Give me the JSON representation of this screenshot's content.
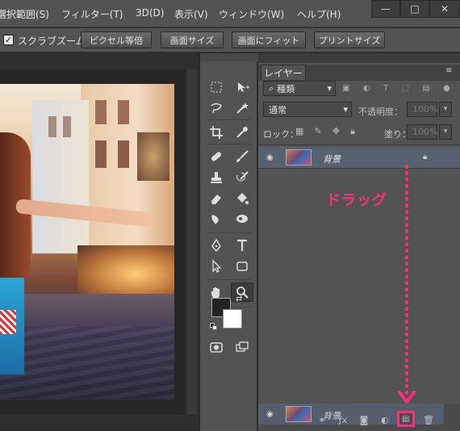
{
  "menu": {
    "items": [
      "選択範囲(S)",
      "フィルター(T)",
      "3D(D)",
      "表示(V)",
      "ウィンドウ(W)",
      "ヘルプ(H)"
    ],
    "window_controls": [
      "—",
      "□",
      "✕"
    ]
  },
  "options": {
    "scrubby_zoom_label": "スクラブズーム",
    "scrubby_zoom_checked": "✓",
    "buttons": [
      "ピクセル等倍",
      "画面サイズ",
      "画面にフィット",
      "プリントサイズ"
    ]
  },
  "layers_panel": {
    "tab_label": "レイヤー",
    "filter_kind": "種類",
    "blend_mode": "通常",
    "opacity_label": "不透明度：",
    "opacity_value": "100%",
    "lock_label": "ロック：",
    "fill_label": "塗り：",
    "fill_value": "100%",
    "layers": [
      {
        "name": "背景",
        "locked": true,
        "visible": true
      }
    ],
    "drag_preview_name": "背景"
  },
  "annotation": {
    "drag_label": "ドラッグ",
    "accent_color": "#ff2f7a"
  },
  "icons": {
    "tools": [
      "marquee-icon",
      "move-icon",
      "lasso-icon",
      "magic-wand-icon",
      "crop-icon",
      "eyedropper-icon",
      "spot-heal-icon",
      "brush-icon",
      "stamp-icon",
      "history-brush-icon",
      "eraser-icon",
      "paint-bucket-icon",
      "blur-icon",
      "dodge-icon",
      "pen-icon",
      "type-icon",
      "path-select-icon",
      "shape-icon",
      "hand-icon",
      "zoom-icon"
    ]
  }
}
